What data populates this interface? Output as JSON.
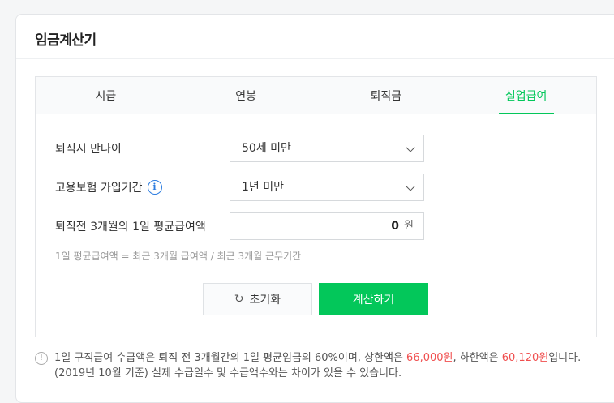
{
  "card": {
    "title": "임금계산기"
  },
  "tabs": [
    {
      "label": "시급"
    },
    {
      "label": "연봉"
    },
    {
      "label": "퇴직금"
    },
    {
      "label": "실업급여"
    }
  ],
  "active_tab": "실업급여",
  "form": {
    "age": {
      "label": "퇴직시 만나이",
      "value": "50세 미만"
    },
    "insurance": {
      "label": "고용보험 가입기간",
      "value": "1년 미만",
      "info_icon": "info-icon"
    },
    "average_wage": {
      "label": "퇴직전 3개월의 1일 평균급여액",
      "value": "0",
      "unit": "원"
    },
    "hint": "1일 평균급여액 = 최근 3개월 급여액 / 최근 3개월 근무기간"
  },
  "buttons": {
    "reset_label": "초기화",
    "reset_icon": "refresh-icon",
    "calculate_label": "계산하기"
  },
  "notice": {
    "icon": "warning-icon",
    "part1": "1일 구직급여 수급액은 퇴직 전 3개월간의 1일 평균임금의 60%이며, 상한액은 ",
    "upper_limit": "66,000원",
    "part2": ", 하한액은 ",
    "lower_limit": "60,120원",
    "part3": "입니다. (2019년 10월 기준) 실제 수급일수 및 수급액수와는 차이가 있을 수 있습니다."
  },
  "colors": {
    "accent": "#03c75a",
    "highlight": "#f04f4f",
    "info": "#2d7de0"
  }
}
